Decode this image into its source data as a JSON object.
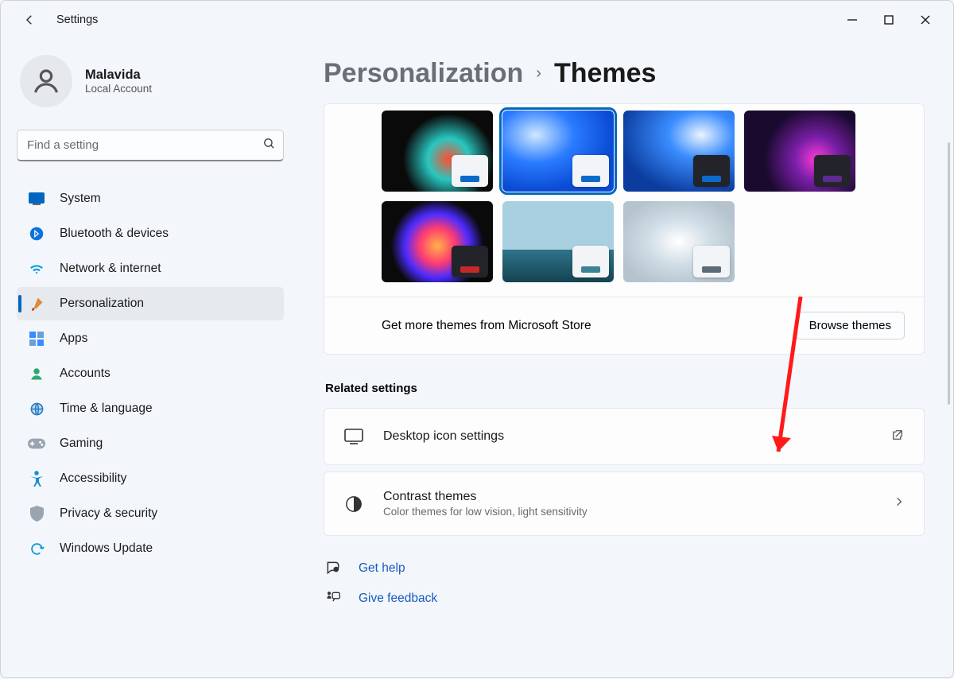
{
  "window": {
    "app_title": "Settings"
  },
  "user": {
    "name": "Malavida",
    "subtitle": "Local Account"
  },
  "search": {
    "placeholder": "Find a setting"
  },
  "nav": {
    "items": [
      {
        "label": "System",
        "icon": "system"
      },
      {
        "label": "Bluetooth & devices",
        "icon": "bluetooth"
      },
      {
        "label": "Network & internet",
        "icon": "wifi"
      },
      {
        "label": "Personalization",
        "icon": "brush"
      },
      {
        "label": "Apps",
        "icon": "apps"
      },
      {
        "label": "Accounts",
        "icon": "account"
      },
      {
        "label": "Time & language",
        "icon": "globe"
      },
      {
        "label": "Gaming",
        "icon": "gaming"
      },
      {
        "label": "Accessibility",
        "icon": "accessibility"
      },
      {
        "label": "Privacy & security",
        "icon": "shield"
      },
      {
        "label": "Windows Update",
        "icon": "update"
      }
    ],
    "selected_index": 3
  },
  "breadcrumb": {
    "parent": "Personalization",
    "current": "Themes"
  },
  "themes": {
    "selected_index": 1,
    "items": [
      {
        "swatch_bg": "#f2f4f7",
        "accent": "#0b6bcb"
      },
      {
        "swatch_bg": "#f2f4f7",
        "accent": "#0b6bcb"
      },
      {
        "swatch_bg": "#22242a",
        "accent": "#0b6bcb"
      },
      {
        "swatch_bg": "#22242a",
        "accent": "#5b2b8f"
      },
      {
        "swatch_bg": "#22242a",
        "accent": "#c62828"
      },
      {
        "swatch_bg": "#f2f4f7",
        "accent": "#3a8494"
      },
      {
        "swatch_bg": "#f2f4f7",
        "accent": "#5a6b76"
      }
    ]
  },
  "store_row": {
    "text": "Get more themes from Microsoft Store",
    "button": "Browse themes"
  },
  "related": {
    "title": "Related settings",
    "rows": [
      {
        "title": "Desktop icon settings",
        "subtitle": "",
        "action": "external"
      },
      {
        "title": "Contrast themes",
        "subtitle": "Color themes for low vision, light sensitivity",
        "action": "chevron"
      }
    ]
  },
  "help": {
    "get_help": "Get help",
    "give_feedback": "Give feedback"
  }
}
